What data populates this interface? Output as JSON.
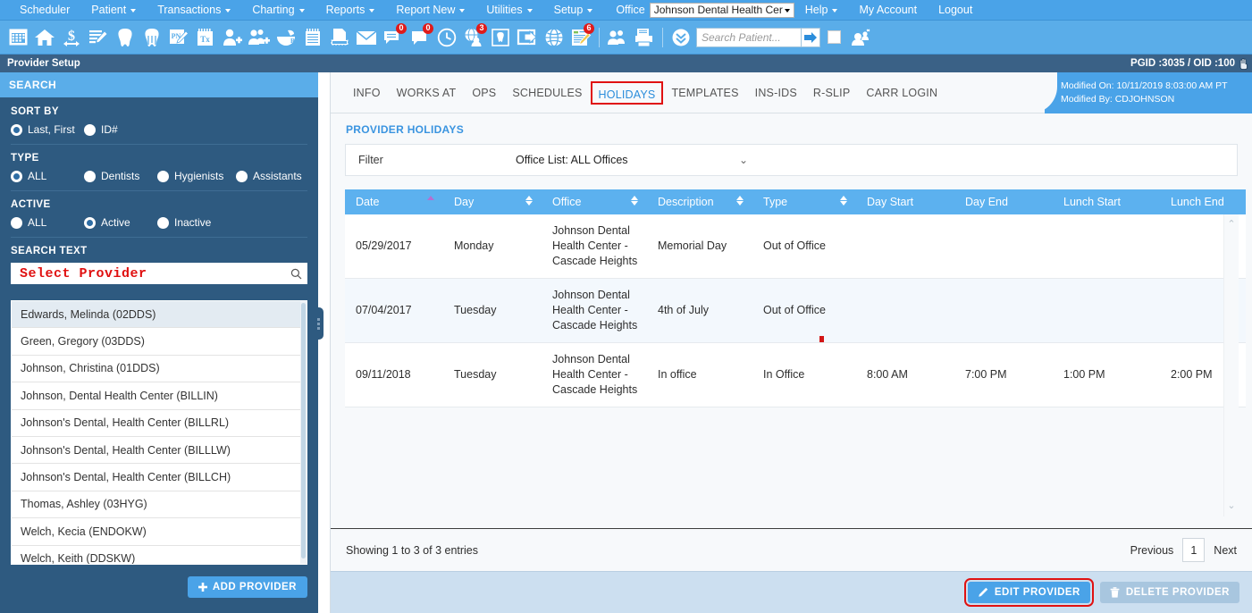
{
  "menubar": {
    "items": [
      {
        "label": "Scheduler",
        "caret": false
      },
      {
        "label": "Patient",
        "caret": true
      },
      {
        "label": "Transactions",
        "caret": true
      },
      {
        "label": "Charting",
        "caret": true
      },
      {
        "label": "Reports",
        "caret": true
      },
      {
        "label": "Report New",
        "caret": true
      },
      {
        "label": "Utilities",
        "caret": true
      },
      {
        "label": "Setup",
        "caret": true
      }
    ],
    "office_label": "Office",
    "office_value": "Johnson Dental Health Cer",
    "right_items": [
      {
        "label": "Help",
        "caret": true
      },
      {
        "label": "My Account",
        "caret": false
      },
      {
        "label": "Logout",
        "caret": false
      }
    ]
  },
  "toolbar": {
    "icons": [
      {
        "name": "calendar-grid-icon",
        "badge": ""
      },
      {
        "name": "home-icon",
        "badge": ""
      },
      {
        "name": "dollar-transfer-icon",
        "badge": ""
      },
      {
        "name": "notes-edit-icon",
        "badge": ""
      },
      {
        "name": "tooth-icon",
        "badge": ""
      },
      {
        "name": "tooth-perio-icon",
        "badge": ""
      },
      {
        "name": "perio-pen-icon",
        "badge": ""
      },
      {
        "name": "treatment-plan-icon",
        "badge": ""
      },
      {
        "name": "add-patient-icon",
        "badge": ""
      },
      {
        "name": "add-family-icon",
        "badge": ""
      },
      {
        "name": "prescription-rx-icon",
        "badge": ""
      },
      {
        "name": "notepad-icon",
        "badge": ""
      },
      {
        "name": "print-document-icon",
        "badge": ""
      },
      {
        "name": "envelope-mail-icon",
        "badge": ""
      },
      {
        "name": "messages-icon",
        "badge": "0"
      },
      {
        "name": "chat-bubble-icon",
        "badge": "0"
      },
      {
        "name": "clock-icon",
        "badge": ""
      },
      {
        "name": "global-patient-icon",
        "badge": "3"
      },
      {
        "name": "tooth-frame-icon",
        "badge": ""
      },
      {
        "name": "export-screen-icon",
        "badge": ""
      },
      {
        "name": "globe-icon",
        "badge": ""
      },
      {
        "name": "ledger-edit-icon",
        "badge": "6"
      },
      {
        "name": "users-icon",
        "badge": ""
      },
      {
        "name": "print-batch-icon",
        "badge": ""
      },
      {
        "name": "collapse-chevrons-icon",
        "badge": ""
      }
    ],
    "search_placeholder": "Search Patient...",
    "go_icon": "arrow-right-icon",
    "group-icon": "patient-group-icon"
  },
  "titlebar": {
    "title": "Provider Setup",
    "ids": "PGID :3035 / OID :100"
  },
  "sidebar": {
    "header": "SEARCH",
    "groups": [
      {
        "label": "SORT BY",
        "options": [
          {
            "label": "Last, First",
            "selected": true
          },
          {
            "label": "ID#",
            "selected": false
          }
        ]
      },
      {
        "label": "TYPE",
        "options": [
          {
            "label": "ALL",
            "selected": true
          },
          {
            "label": "Dentists",
            "selected": false
          },
          {
            "label": "Hygienists",
            "selected": false
          },
          {
            "label": "Assistants",
            "selected": false
          }
        ]
      },
      {
        "label": "ACTIVE",
        "options": [
          {
            "label": "ALL",
            "selected": false
          },
          {
            "label": "Active",
            "selected": true
          },
          {
            "label": "Inactive",
            "selected": false
          }
        ]
      }
    ],
    "search_text_label": "SEARCH TEXT",
    "search_value": "Select Provider",
    "search_icon": "magnifier-icon",
    "providers": [
      {
        "label": "Edwards, Melinda (02DDS)",
        "selected": true
      },
      {
        "label": "Green, Gregory (03DDS)",
        "selected": false
      },
      {
        "label": "Johnson, Christina (01DDS)",
        "selected": false
      },
      {
        "label": "Johnson, Dental Health Center (BILLIN)",
        "selected": false
      },
      {
        "label": "Johnson's Dental, Health Center (BILLRL)",
        "selected": false
      },
      {
        "label": "Johnson's Dental, Health Center (BILLLW)",
        "selected": false
      },
      {
        "label": "Johnson's Dental, Health Center (BILLCH)",
        "selected": false
      },
      {
        "label": "Thomas, Ashley (03HYG)",
        "selected": false
      },
      {
        "label": "Welch, Kecia (ENDOKW)",
        "selected": false
      },
      {
        "label": "Welch, Keith (DDSKW)",
        "selected": false
      }
    ],
    "add_provider_label": "ADD PROVIDER",
    "add_provider_icon": "plus-icon"
  },
  "main": {
    "modified_on": "Modified On: 10/11/2019 8:03:00 AM PT",
    "modified_by": "Modified By: CDJOHNSON",
    "tabs": [
      {
        "label": "INFO",
        "active": false,
        "boxed": false
      },
      {
        "label": "WORKS AT",
        "active": false,
        "boxed": false
      },
      {
        "label": "OPS",
        "active": false,
        "boxed": false
      },
      {
        "label": "SCHEDULES",
        "active": false,
        "boxed": false
      },
      {
        "label": "HOLIDAYS",
        "active": true,
        "boxed": true
      },
      {
        "label": "TEMPLATES",
        "active": false,
        "boxed": false
      },
      {
        "label": "INS-IDS",
        "active": false,
        "boxed": false
      },
      {
        "label": "R-SLIP",
        "active": false,
        "boxed": false
      },
      {
        "label": "CARR LOGIN",
        "active": false,
        "boxed": false
      }
    ],
    "section_title": "PROVIDER HOLIDAYS",
    "filter": {
      "label": "Filter",
      "value": "Office List: ALL Offices",
      "caret_icon": "chevron-down-icon"
    },
    "table": {
      "columns": [
        {
          "label": "Date",
          "sortable": true,
          "sort": "asc"
        },
        {
          "label": "Day",
          "sortable": true,
          "sort": "none"
        },
        {
          "label": "Office",
          "sortable": true,
          "sort": "none"
        },
        {
          "label": "Description",
          "sortable": true,
          "sort": "none"
        },
        {
          "label": "Type",
          "sortable": true,
          "sort": "none"
        },
        {
          "label": "Day Start",
          "sortable": false,
          "sort": "none"
        },
        {
          "label": "Day End",
          "sortable": false,
          "sort": "none"
        },
        {
          "label": "Lunch Start",
          "sortable": false,
          "sort": "none"
        },
        {
          "label": "Lunch End",
          "sortable": false,
          "sort": "none"
        }
      ],
      "rows": [
        {
          "date": "05/29/2017",
          "day": "Monday",
          "office": "Johnson Dental Health Center - Cascade Heights",
          "description": "Memorial Day",
          "type": "Out of Office",
          "day_start": "",
          "day_end": "",
          "lunch_start": "",
          "lunch_end": ""
        },
        {
          "date": "07/04/2017",
          "day": "Tuesday",
          "office": "Johnson Dental Health Center - Cascade Heights",
          "description": "4th of July",
          "type": "Out of Office",
          "day_start": "",
          "day_end": "",
          "lunch_start": "",
          "lunch_end": ""
        },
        {
          "date": "09/11/2018",
          "day": "Tuesday",
          "office": "Johnson Dental Health Center - Cascade Heights",
          "description": "In office",
          "type": "In Office",
          "day_start": "8:00 AM",
          "day_end": "7:00 PM",
          "lunch_start": "1:00 PM",
          "lunch_end": "2:00 PM"
        }
      ]
    },
    "showing_text": "Showing 1 to 3 of 3 entries",
    "pager": {
      "previous": "Previous",
      "current_page": "1",
      "next": "Next"
    },
    "actions": [
      {
        "label": "EDIT PROVIDER",
        "icon": "pencil-icon",
        "style": "primary",
        "highlighted": true
      },
      {
        "label": "DELETE PROVIDER",
        "icon": "trash-icon",
        "style": "secondary",
        "highlighted": false
      }
    ]
  },
  "colors": {
    "accent_blue": "#4aa3e8",
    "header_blue": "#5cb1ef",
    "sidebar_navy": "#2e5a80",
    "title_navy": "#3a6186",
    "highlight_red": "#e01111",
    "search_text_red": "#e01010",
    "action_bar": "#ccdff0"
  }
}
